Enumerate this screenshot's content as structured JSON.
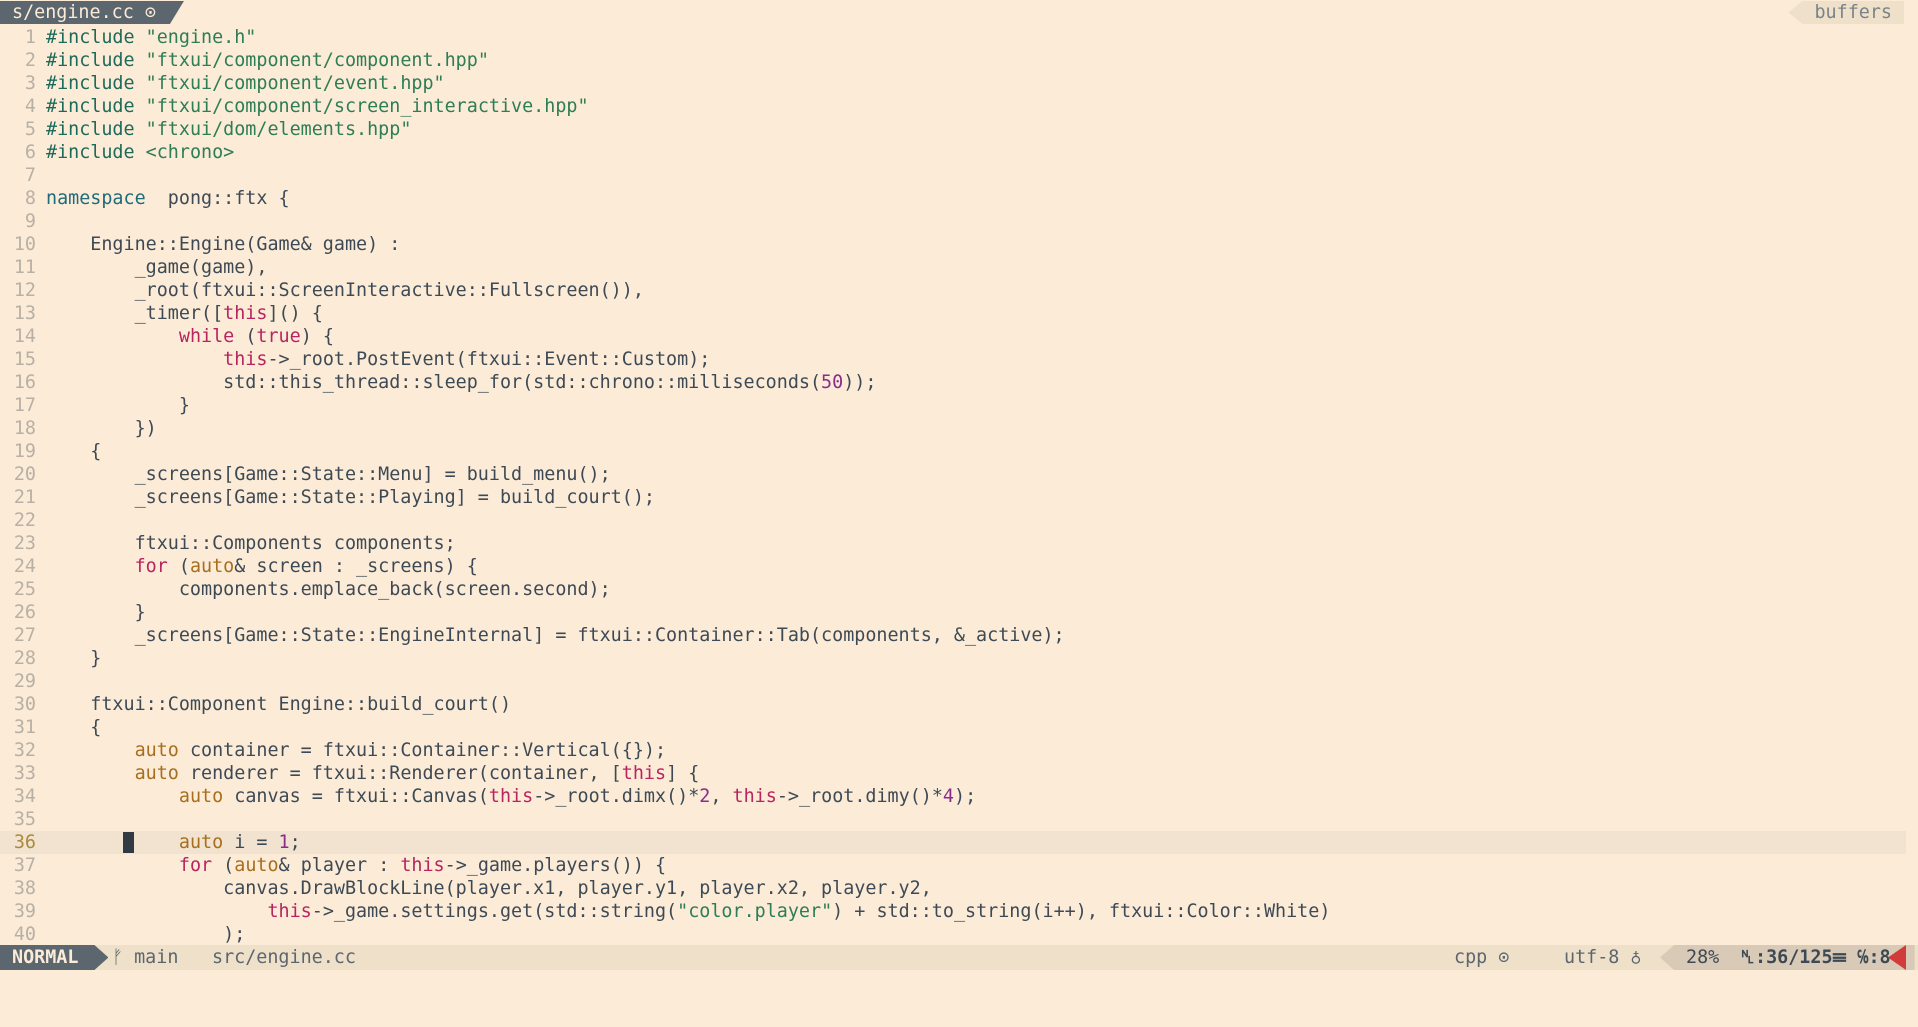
{
  "tabline": {
    "active_tab": "s/engine.cc ⊙",
    "buffers_label": "buffers"
  },
  "editor": {
    "language": "cpp",
    "cursor_line": 36,
    "lines": [
      {
        "n": "1",
        "c": [
          [
            "pp",
            "#include "
          ],
          [
            "str",
            "\"engine.h\""
          ]
        ]
      },
      {
        "n": "2",
        "c": [
          [
            "pp",
            "#include "
          ],
          [
            "str",
            "\"ftxui/component/component.hpp\""
          ]
        ]
      },
      {
        "n": "3",
        "c": [
          [
            "pp",
            "#include "
          ],
          [
            "str",
            "\"ftxui/component/event.hpp\""
          ]
        ]
      },
      {
        "n": "4",
        "c": [
          [
            "pp",
            "#include "
          ],
          [
            "str",
            "\"ftxui/component/screen_interactive.hpp\""
          ]
        ]
      },
      {
        "n": "5",
        "c": [
          [
            "pp",
            "#include "
          ],
          [
            "str",
            "\"ftxui/dom/elements.hpp\""
          ]
        ]
      },
      {
        "n": "6",
        "c": [
          [
            "pp",
            "#include "
          ],
          [
            "str",
            "<chrono>"
          ]
        ]
      },
      {
        "n": "7",
        "c": []
      },
      {
        "n": "8",
        "c": [
          [
            "ns",
            "namespace"
          ],
          [
            "",
            "  pong::ftx {"
          ]
        ]
      },
      {
        "n": "9",
        "c": []
      },
      {
        "n": "10",
        "c": [
          [
            "",
            "    Engine::Engine(Game& game) :"
          ]
        ]
      },
      {
        "n": "11",
        "c": [
          [
            "",
            "        _game(game),"
          ]
        ]
      },
      {
        "n": "12",
        "c": [
          [
            "",
            "        _root(ftxui::ScreenInteractive::Fullscreen()),"
          ]
        ]
      },
      {
        "n": "13",
        "c": [
          [
            "",
            "        _timer(["
          ],
          [
            "kw",
            "this"
          ],
          [
            "",
            "]() {"
          ]
        ]
      },
      {
        "n": "14",
        "c": [
          [
            "",
            "            "
          ],
          [
            "kw",
            "while"
          ],
          [
            "",
            " ("
          ],
          [
            "kw",
            "true"
          ],
          [
            "",
            ") {"
          ]
        ]
      },
      {
        "n": "15",
        "c": [
          [
            "",
            "                "
          ],
          [
            "kw",
            "this"
          ],
          [
            "",
            "->_root.PostEvent(ftxui::Event::Custom);"
          ]
        ]
      },
      {
        "n": "16",
        "c": [
          [
            "",
            "                std::this_thread::sleep_for(std::chrono::milliseconds("
          ],
          [
            "num",
            "50"
          ],
          [
            "",
            "));"
          ]
        ]
      },
      {
        "n": "17",
        "c": [
          [
            "",
            "            }"
          ]
        ]
      },
      {
        "n": "18",
        "c": [
          [
            "",
            "        })"
          ]
        ]
      },
      {
        "n": "19",
        "c": [
          [
            "",
            "    {"
          ]
        ]
      },
      {
        "n": "20",
        "c": [
          [
            "",
            "        _screens[Game::State::Menu] = build_menu();"
          ]
        ]
      },
      {
        "n": "21",
        "c": [
          [
            "",
            "        _screens[Game::State::Playing] = build_court();"
          ]
        ]
      },
      {
        "n": "22",
        "c": []
      },
      {
        "n": "23",
        "c": [
          [
            "",
            "        ftxui::Components components;"
          ]
        ]
      },
      {
        "n": "24",
        "c": [
          [
            "",
            "        "
          ],
          [
            "kw",
            "for"
          ],
          [
            "",
            " ("
          ],
          [
            "ty",
            "auto"
          ],
          [
            "",
            "& screen : _screens) {"
          ]
        ]
      },
      {
        "n": "25",
        "c": [
          [
            "",
            "            components.emplace_back(screen.second);"
          ]
        ]
      },
      {
        "n": "26",
        "c": [
          [
            "",
            "        }"
          ]
        ]
      },
      {
        "n": "27",
        "c": [
          [
            "",
            "        _screens[Game::State::EngineInternal] = ftxui::Container::Tab(components, &_active);"
          ]
        ]
      },
      {
        "n": "28",
        "c": [
          [
            "",
            "    }"
          ]
        ]
      },
      {
        "n": "29",
        "c": []
      },
      {
        "n": "30",
        "c": [
          [
            "",
            "    ftxui::Component Engine::build_court()"
          ]
        ]
      },
      {
        "n": "31",
        "c": [
          [
            "",
            "    {"
          ]
        ]
      },
      {
        "n": "32",
        "c": [
          [
            "",
            "        "
          ],
          [
            "ty",
            "auto"
          ],
          [
            "",
            " container = ftxui::Container::Vertical({});"
          ]
        ]
      },
      {
        "n": "33",
        "c": [
          [
            "",
            "        "
          ],
          [
            "ty",
            "auto"
          ],
          [
            "",
            " renderer = ftxui::Renderer(container, ["
          ],
          [
            "kw",
            "this"
          ],
          [
            "",
            "] {"
          ]
        ]
      },
      {
        "n": "34",
        "c": [
          [
            "",
            "            "
          ],
          [
            "ty",
            "auto"
          ],
          [
            "",
            " canvas = ftxui::Canvas("
          ],
          [
            "kw",
            "this"
          ],
          [
            "",
            "->_root.dimx()*"
          ],
          [
            "num",
            "2"
          ],
          [
            "",
            ", "
          ],
          [
            "kw",
            "this"
          ],
          [
            "",
            "->_root.dimy()*"
          ],
          [
            "num",
            "4"
          ],
          [
            "",
            ");"
          ]
        ]
      },
      {
        "n": "35",
        "c": []
      },
      {
        "n": "36",
        "c": [
          [
            "",
            "            "
          ],
          [
            "ty",
            "auto"
          ],
          [
            "",
            " i = "
          ],
          [
            "num",
            "1"
          ],
          [
            "",
            ";"
          ]
        ]
      },
      {
        "n": "37",
        "c": [
          [
            "",
            "            "
          ],
          [
            "kw",
            "for"
          ],
          [
            "",
            " ("
          ],
          [
            "ty",
            "auto"
          ],
          [
            "",
            "& player : "
          ],
          [
            "kw",
            "this"
          ],
          [
            "",
            "->_game.players()) {"
          ]
        ]
      },
      {
        "n": "38",
        "c": [
          [
            "",
            "                canvas.DrawBlockLine(player.x1, player.y1, player.x2, player.y2,"
          ]
        ]
      },
      {
        "n": "39",
        "c": [
          [
            "",
            "                    "
          ],
          [
            "kw",
            "this"
          ],
          [
            "",
            "->_game.settings.get(std::string("
          ],
          [
            "str",
            "\"color.player\""
          ],
          [
            "",
            ") + std::to_string(i++), ftxui::Color::White)"
          ]
        ]
      },
      {
        "n": "40",
        "c": [
          [
            "",
            "                );"
          ]
        ]
      }
    ]
  },
  "statusline": {
    "mode": "NORMAL",
    "branch": "ᚠ main",
    "file": "src/engine.cc",
    "filetype": "cpp ⊙",
    "encoding": "utf-8 ♁",
    "percent": "28%",
    "line_col": "␤:36/125☰ ℅:8"
  },
  "colors": {
    "background": "#fbebd7",
    "keyword": "#b8245f",
    "type": "#a86e1e",
    "string": "#2d7d55",
    "number": "#8b2b8b",
    "status_bg": "#efe0ca",
    "mode_bg": "#5b666e",
    "error_accent": "#d23b3b"
  }
}
